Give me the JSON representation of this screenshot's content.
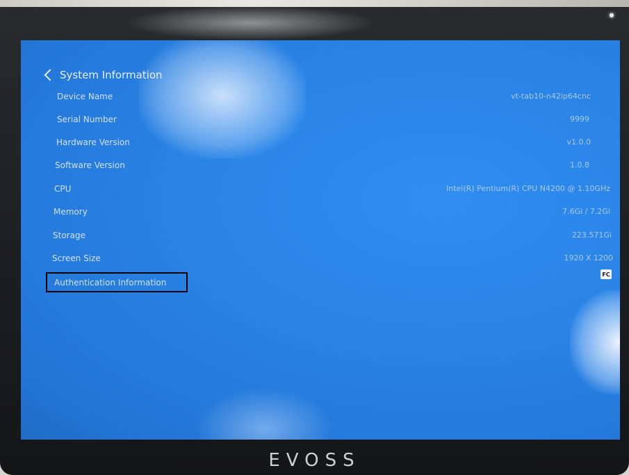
{
  "header": {
    "title": "System Information"
  },
  "info_rows": [
    {
      "label": "Device Name",
      "value": "vt-tab10-n42ip64cnc"
    },
    {
      "label": "Serial Number",
      "value": "9999"
    },
    {
      "label": "Hardware Version",
      "value": "v1.0.0"
    },
    {
      "label": "Software Version",
      "value": "1.0.8"
    },
    {
      "label": "CPU",
      "value": "Intel(R) Pentium(R) CPU N4200 @ 1.10GHz"
    },
    {
      "label": "Memory",
      "value": "7.6Gi / 7.2Gi"
    },
    {
      "label": "Storage",
      "value": "223.571Gi"
    },
    {
      "label": "Screen Size",
      "value": "1920 X 1200"
    }
  ],
  "auth": {
    "label": "Authentication Information",
    "badge": "FC",
    "badge_icon": "fcc-certification-icon"
  },
  "device": {
    "brand": "EVOSS"
  },
  "colors": {
    "screen_blue": "#2a84e6",
    "text_light": "#cfe1f8",
    "value_text": "#a9c9ef",
    "highlight_border": "#000000"
  }
}
